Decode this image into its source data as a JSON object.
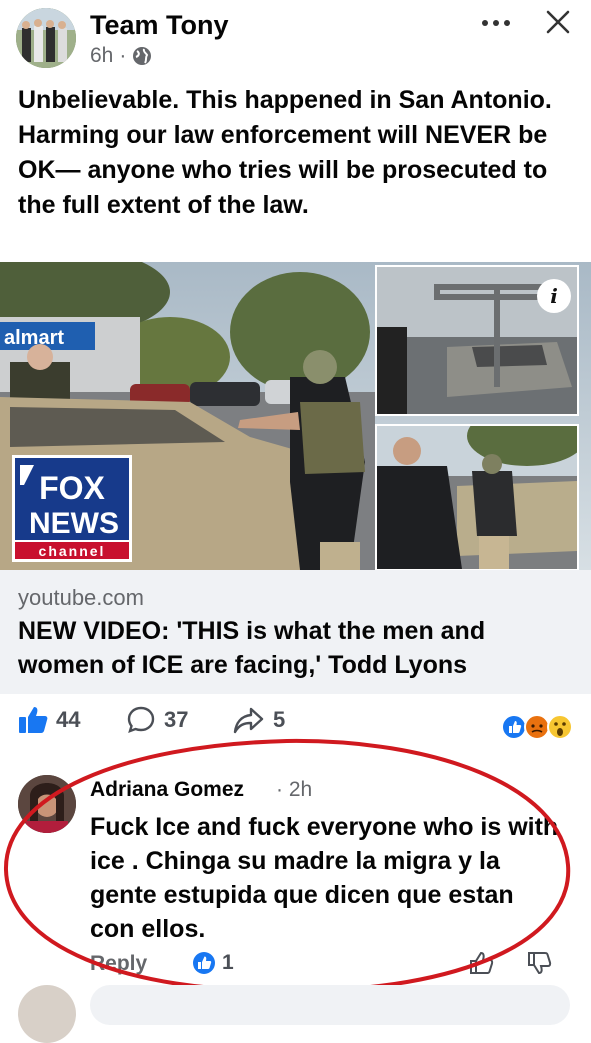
{
  "header": {
    "page_name": "Team Tony",
    "time": "6h",
    "separator": "·",
    "audience_icon": "globe-icon",
    "more_icon": "more-icon",
    "close_icon": "close-icon"
  },
  "post": {
    "text": "Unbelievable. This happened in San Antonio. Harming our law enforcement will NEVER be OK— anyone who tries will be prosecuted to the full extent of the law."
  },
  "media": {
    "info_glyph": "i",
    "logo_text_1": "FOX",
    "logo_text_2": "NEWS",
    "logo_text_3": "channel",
    "store_sign": "almart"
  },
  "link": {
    "domain": "youtube.com",
    "title": "NEW VIDEO: 'THIS is what the men and women of ICE are facing,' Todd Lyons"
  },
  "reactions": {
    "like_count": "44",
    "comment_count": "37",
    "share_count": "5"
  },
  "comment": {
    "author": "Adriana Gomez",
    "time": "· 2h",
    "text": "Fuck Ice and fuck everyone who is with ice . Chinga su madre la migra y la gente estupida  que dicen que estan con ellos.",
    "reply_label": "Reply",
    "like_count": "1"
  },
  "colors": {
    "brand_blue": "#1877f2",
    "annotation_red": "#d0191f",
    "secondary_text": "#65676b"
  }
}
